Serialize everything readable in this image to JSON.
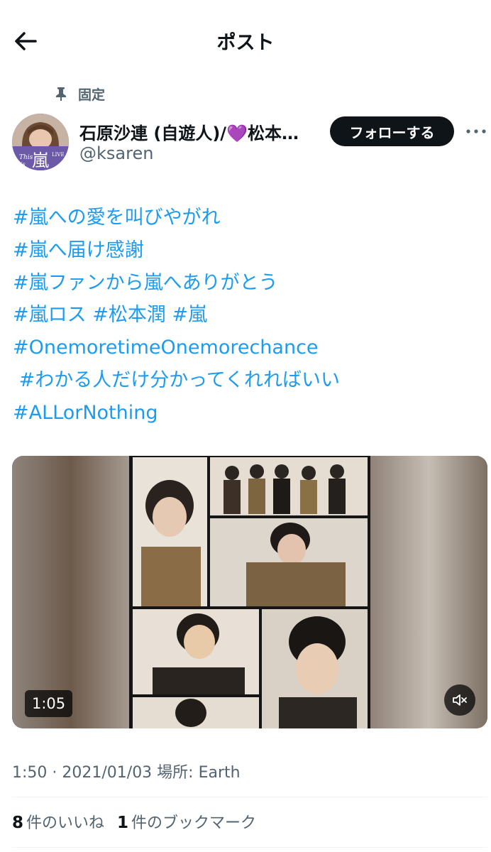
{
  "header": {
    "title": "ポスト"
  },
  "pinned": {
    "label": "固定"
  },
  "author": {
    "display_name": "石原沙連 (自遊人)/💜松本…",
    "handle": "@ksaren",
    "avatar_text": "This is 嵐 LIVE"
  },
  "follow_button": {
    "label": "フォローする"
  },
  "post": {
    "lines": [
      "#嵐への愛を叫びやがれ",
      "#嵐へ届け感謝",
      "#嵐ファンから嵐へありがとう",
      "#嵐ロス #松本潤 #嵐",
      "#OnemoretimeOnemorechance",
      " #わかる人だけ分かってくれればいい",
      "#ALLorNothing"
    ]
  },
  "media": {
    "duration": "1:05",
    "mute_icon": "volume-muted-icon"
  },
  "meta": {
    "text": "1:50 · 2021/01/03 場所: Earth"
  },
  "stats": {
    "likes_count": "8",
    "likes_label": "件のいいね",
    "bookmarks_count": "1",
    "bookmarks_label": "件のブックマーク"
  },
  "colors": {
    "link": "#1d9bf0",
    "text": "#0f1419",
    "secondary": "#536471"
  }
}
